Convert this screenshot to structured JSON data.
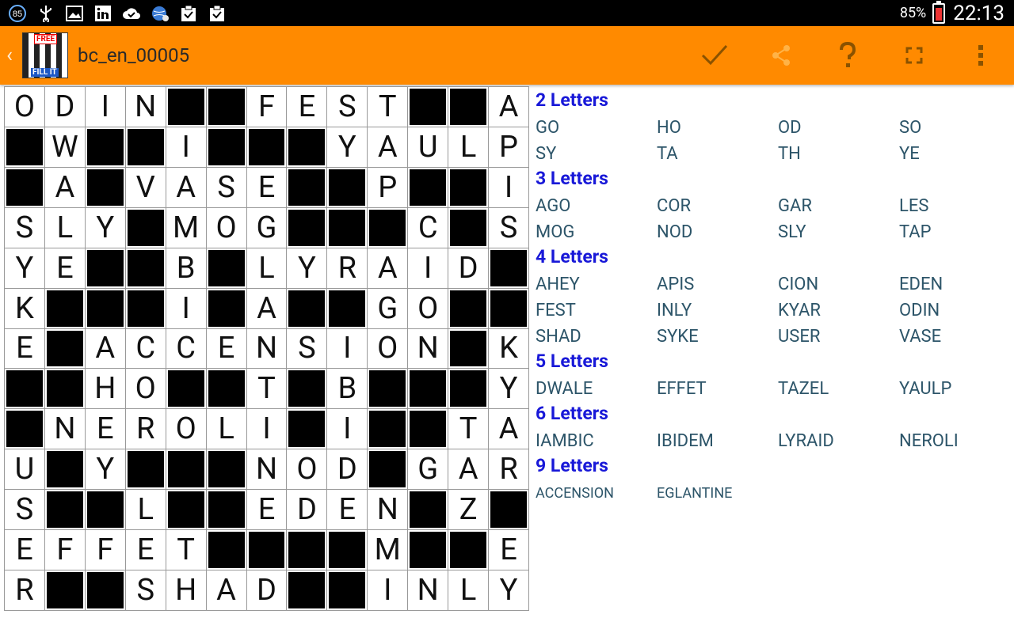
{
  "status_bar": {
    "icons": [
      "notification-badge-icon",
      "usb-icon",
      "gallery-icon",
      "linkedin-icon",
      "cloud-done-icon",
      "globe-icon",
      "clipboard-icon",
      "clipboard-check-icon"
    ],
    "badge_count": "85",
    "battery": "85%",
    "time": "22:13"
  },
  "action_bar": {
    "title": "bc_en_00005",
    "logo_top": "FREE",
    "logo_bottom": "FILL IT",
    "actions": [
      "check-icon",
      "share-icon",
      "help-icon",
      "fullscreen-icon",
      "overflow-menu-icon"
    ]
  },
  "grid": {
    "rows": [
      "ODIN##FEST##A",
      "#W##I###YAULP",
      "#A#VASE##P##I",
      "SLY#MOG###C#S",
      "YE##B#LYRAID#",
      "K###I#A##GO##",
      "E#ACCENSION#K",
      "##HO##T#B###Y",
      "#NEROLI#I##TA",
      "U#Y###NOD#GAR",
      "S##L##EDEN#Z#",
      "EFFET####M##E",
      "R##SHAD##INLY"
    ]
  },
  "word_groups": [
    {
      "title": "2 Letters",
      "words": [
        "GO",
        "HO",
        "OD",
        "SO",
        "SY",
        "TA",
        "TH",
        "YE"
      ]
    },
    {
      "title": "3 Letters",
      "words": [
        "AGO",
        "COR",
        "GAR",
        "LES",
        "MOG",
        "NOD",
        "SLY",
        "TAP"
      ]
    },
    {
      "title": "4 Letters",
      "words": [
        "AHEY",
        "APIS",
        "CION",
        "EDEN",
        "FEST",
        "INLY",
        "KYAR",
        "ODIN",
        "SHAD",
        "SYKE",
        "USER",
        "VASE"
      ]
    },
    {
      "title": "5 Letters",
      "words": [
        "DWALE",
        "EFFET",
        "TAZEL",
        "YAULP"
      ]
    },
    {
      "title": "6 Letters",
      "words": [
        "IAMBIC",
        "IBIDEM",
        "LYRAID",
        "NEROLI"
      ]
    },
    {
      "title": "9 Letters",
      "words": [
        "ACCENSION",
        "EGLANTINE"
      ]
    }
  ],
  "colors": {
    "action_bar": "#ff8a00",
    "group_title": "#1818d8",
    "word": "#2d5569"
  }
}
